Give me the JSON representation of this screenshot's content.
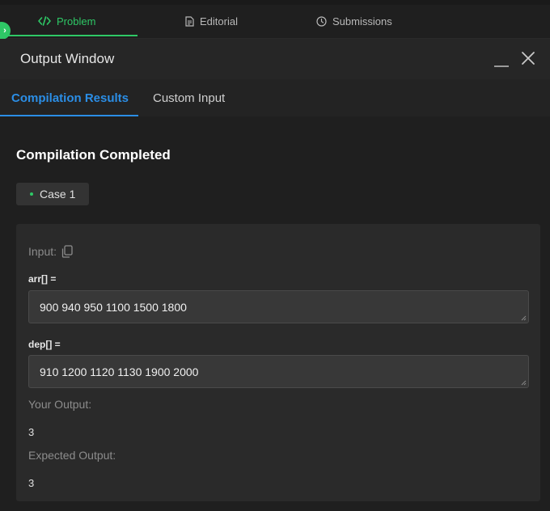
{
  "top_tabs": {
    "problem": "Problem",
    "editorial": "Editorial",
    "submissions": "Submissions"
  },
  "output_window": {
    "title": "Output Window",
    "tabs": [
      "Compilation Results",
      "Custom Input"
    ],
    "status": "Compilation Completed",
    "case_label": "Case 1",
    "input_label": "Input:",
    "inputs": [
      {
        "name": "arr[] =",
        "value": "900 940 950 1100 1500 1800"
      },
      {
        "name": "dep[] =",
        "value": "910 1200 1120 1130 1900 2000"
      }
    ],
    "your_output_label": "Your Output:",
    "your_output": "3",
    "expected_output_label": "Expected Output:",
    "expected_output": "3"
  },
  "colors": {
    "accent_green": "#2ec866",
    "accent_blue": "#2b8ee6",
    "background": "#1f1f1f",
    "panel": "#2a2a2a"
  },
  "icons": {
    "problem": "code-icon",
    "editorial": "document-icon",
    "submissions": "clock-icon",
    "copy": "copy-icon",
    "close": "close-icon",
    "minimize": "minimize-icon",
    "expand": "chevron-right-icon"
  }
}
